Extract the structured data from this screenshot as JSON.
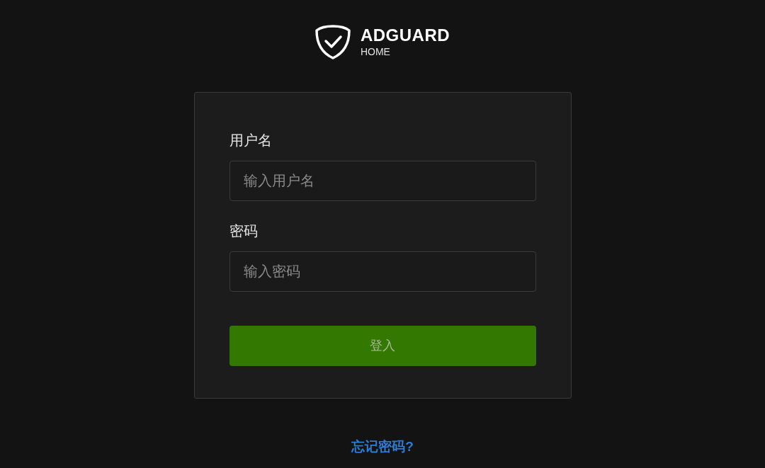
{
  "logo": {
    "name": "ADGUARD",
    "subtitle": "HOME"
  },
  "form": {
    "fields": [
      {
        "label": "用户名",
        "placeholder": "输入用户名"
      },
      {
        "label": "密码",
        "placeholder": "输入密码"
      }
    ],
    "submit": {
      "label": "登入",
      "disabled": true
    }
  },
  "forgot_link": "忘记密码?"
}
